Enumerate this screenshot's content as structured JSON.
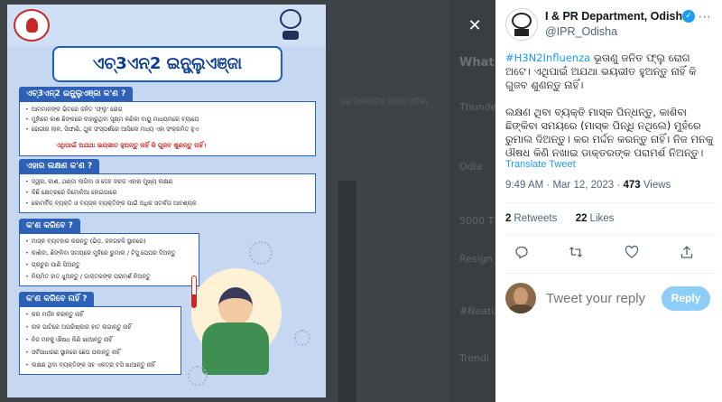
{
  "background": {
    "ghost_texts": [
      "What",
      "Thunde",
      "Odia",
      "5000 T",
      "Resign",
      "#Neatu",
      "Trendi"
    ],
    "ghost_odia": "ରେ ପ୍ରଭାବିତ ହୋଇ ଓଡ଼ିଶା"
  },
  "poster": {
    "title": "ଏଚ୍3ଏନ୍2 ଇନ୍ଫ୍ଲୁଏଞ୍ଜା",
    "sections": [
      {
        "heading": "ଏଚ୍3ଏନ୍2 ଇନ୍ଫ୍ଲୁଏଞ୍ଜା କ'ଣ ?",
        "bullets": [
          "ଆମମାନଙ୍କ ଭିତରେ ଜନିତ 'ଫ୍ଲୁ' ରୋଗ",
          "ମୁହାଁରେ କାଶ ଛିଙ୍କରେ ବାହାରୁଥିବା ସୂକ୍ଷ୍ମ କଣିକା ବାୟୁ ମାଧ୍ୟମରେ ବ୍ୟାପେ",
          "ରୋଗୀର ଲାଳ, ସିଙ୍ଘାଣି, ଥୁକ ସଂସ୍ପର୍ଶରେ ଆସିଲେ ମଧ୍ୟ ଏହା ସଂକ୍ରମିତ ହୁଏ"
        ],
        "highlight": "ଏଥିପାଇଁ ଅଯଥା ଭୟଭୀତ ହୁଅନ୍ତୁ ନାହିଁ କି ଗୁଜବ ଶୁଣନ୍ତୁ ନାହିଁ।"
      },
      {
        "heading": "ଏହାର ଲକ୍ଷଣ କ'ଣ ?",
        "bullets": [
          "ଜ୍ୱର, କାଶ, ଥଣ୍ଡା ଲାଗିବା ଓ ଦେହ ଦରଜ ଏହାର ମୁଖ୍ୟ ଲକ୍ଷଣ",
          "କିଛି କ୍ଷେତ୍ରରେ ନିମୋନିଆ ହୋଇପାରେ",
          "କୋମର୍ବିଡ୍ ବ୍ୟକ୍ତି ଓ ବୟସ୍କ ବ୍ୟକ୍ତିଙ୍କ ପାଇଁ ଅଧିକ ସତର୍କତା ଆବଶ୍ୟକ"
        ]
      },
      {
        "heading": "କ'ଣ କରିବେ ?",
        "bullets": [
          "ମାସ୍କ ବ୍ୟବହାର କରନ୍ତୁ (ଭିଡ଼, ଜନଗହଳି ସ୍ଥାନରେ)",
          "କାଶିବା, ଛିଙ୍କିବା ସମୟରେ ମୁହଁରେ ରୁମାଲ / ଟିସୁ ପେପର ଦିଅନ୍ତୁ",
          "ପ୍ରଚୁର ପାଣି ପିଅନ୍ତୁ",
          "ନିୟମିତ ହାତ ଧୁଅନ୍ତୁ / ଡାକ୍ତରଙ୍କ ପରାମର୍ଶ ନିଅନ୍ତୁ"
        ]
      },
      {
        "heading": "କ'ଣ କରିବେ ନାହିଁ ?",
        "bullets": [
          "କର ମର୍ଦ୍ଦନ କରନ୍ତୁ ନାହିଁ",
          "ନାକ ପାଟିରେ ଅପରିଷ୍କାର ହାତ ଲଗାନ୍ତୁ ନାହିଁ",
          "ନିଜ ମନକୁ ଔଷଧ କିଣି ଖାଆନ୍ତୁ ନାହିଁ",
          "ସର୍ବସାଧାରଣ ସ୍ଥାନରେ ଛେପ ପକାନ୍ତୁ ନାହିଁ",
          "ଲକ୍ଷଣ ଥିବା ବ୍ୟକ୍ତିଙ୍କ ସହ ଏକତ୍ର ବସି ଖାଆନ୍ତୁ ନାହିଁ"
        ]
      }
    ]
  },
  "tweet": {
    "account_name": "I & PR Department, Odisha",
    "handle": "@IPR_Odisha",
    "hashtag": "#H3N2Influenza",
    "paragraph_1_rest": " ଭୂତାଣୁ ଜନିତ ଫ୍ଲୁ ରୋଗ ଅଟେ। ଏଥିପାଇଁ ଅଯଥା ଭୟଭୀତ ହୁଅନ୍ତୁ ନାହିଁ କି ଗୁଜବ ଶୁଣନ୍ତୁ ନାହିଁ।",
    "paragraph_2": "ଲକ୍ଷଣ ଥିବା ବ୍ୟକ୍ତି ମାସ୍କ ପିନ୍ଧନ୍ତୁ, କାଶିବା ଛିଙ୍କିବା ସମୟରେ (ମାସ୍କ ପିନ୍ଧି ନଥିଲେ) ମୁହଁରେ ରୁମାଲ ଦିଅନ୍ତୁ। କର ମର୍ଦ୍ଦନ କରନ୍ତୁ ନାହିଁ। ନିଜ ମନକୁ ଔଷଧ କିଣି ନଖାଇ ଡାକ୍ତରଙ୍କ ପରାମର୍ଶ ନିଅନ୍ତୁ।",
    "translate_label": "Translate Tweet",
    "time": "9:49 AM",
    "date": "Mar 12, 2023",
    "views_count": "473",
    "views_label": "Views",
    "retweets_count": "2",
    "retweets_label": "Retweets",
    "likes_count": "22",
    "likes_label": "Likes",
    "reply_placeholder": "Tweet your reply",
    "reply_button": "Reply"
  },
  "colors": {
    "accent": "#1d9bf0",
    "reply_button_disabled": "#8ecdf8",
    "poster_blue": "#2d62b8",
    "poster_bg": "#c6d8f1"
  },
  "icons": [
    "close-icon",
    "more-icon",
    "verified-badge-icon",
    "reply-icon",
    "retweet-icon",
    "like-icon",
    "share-icon"
  ]
}
